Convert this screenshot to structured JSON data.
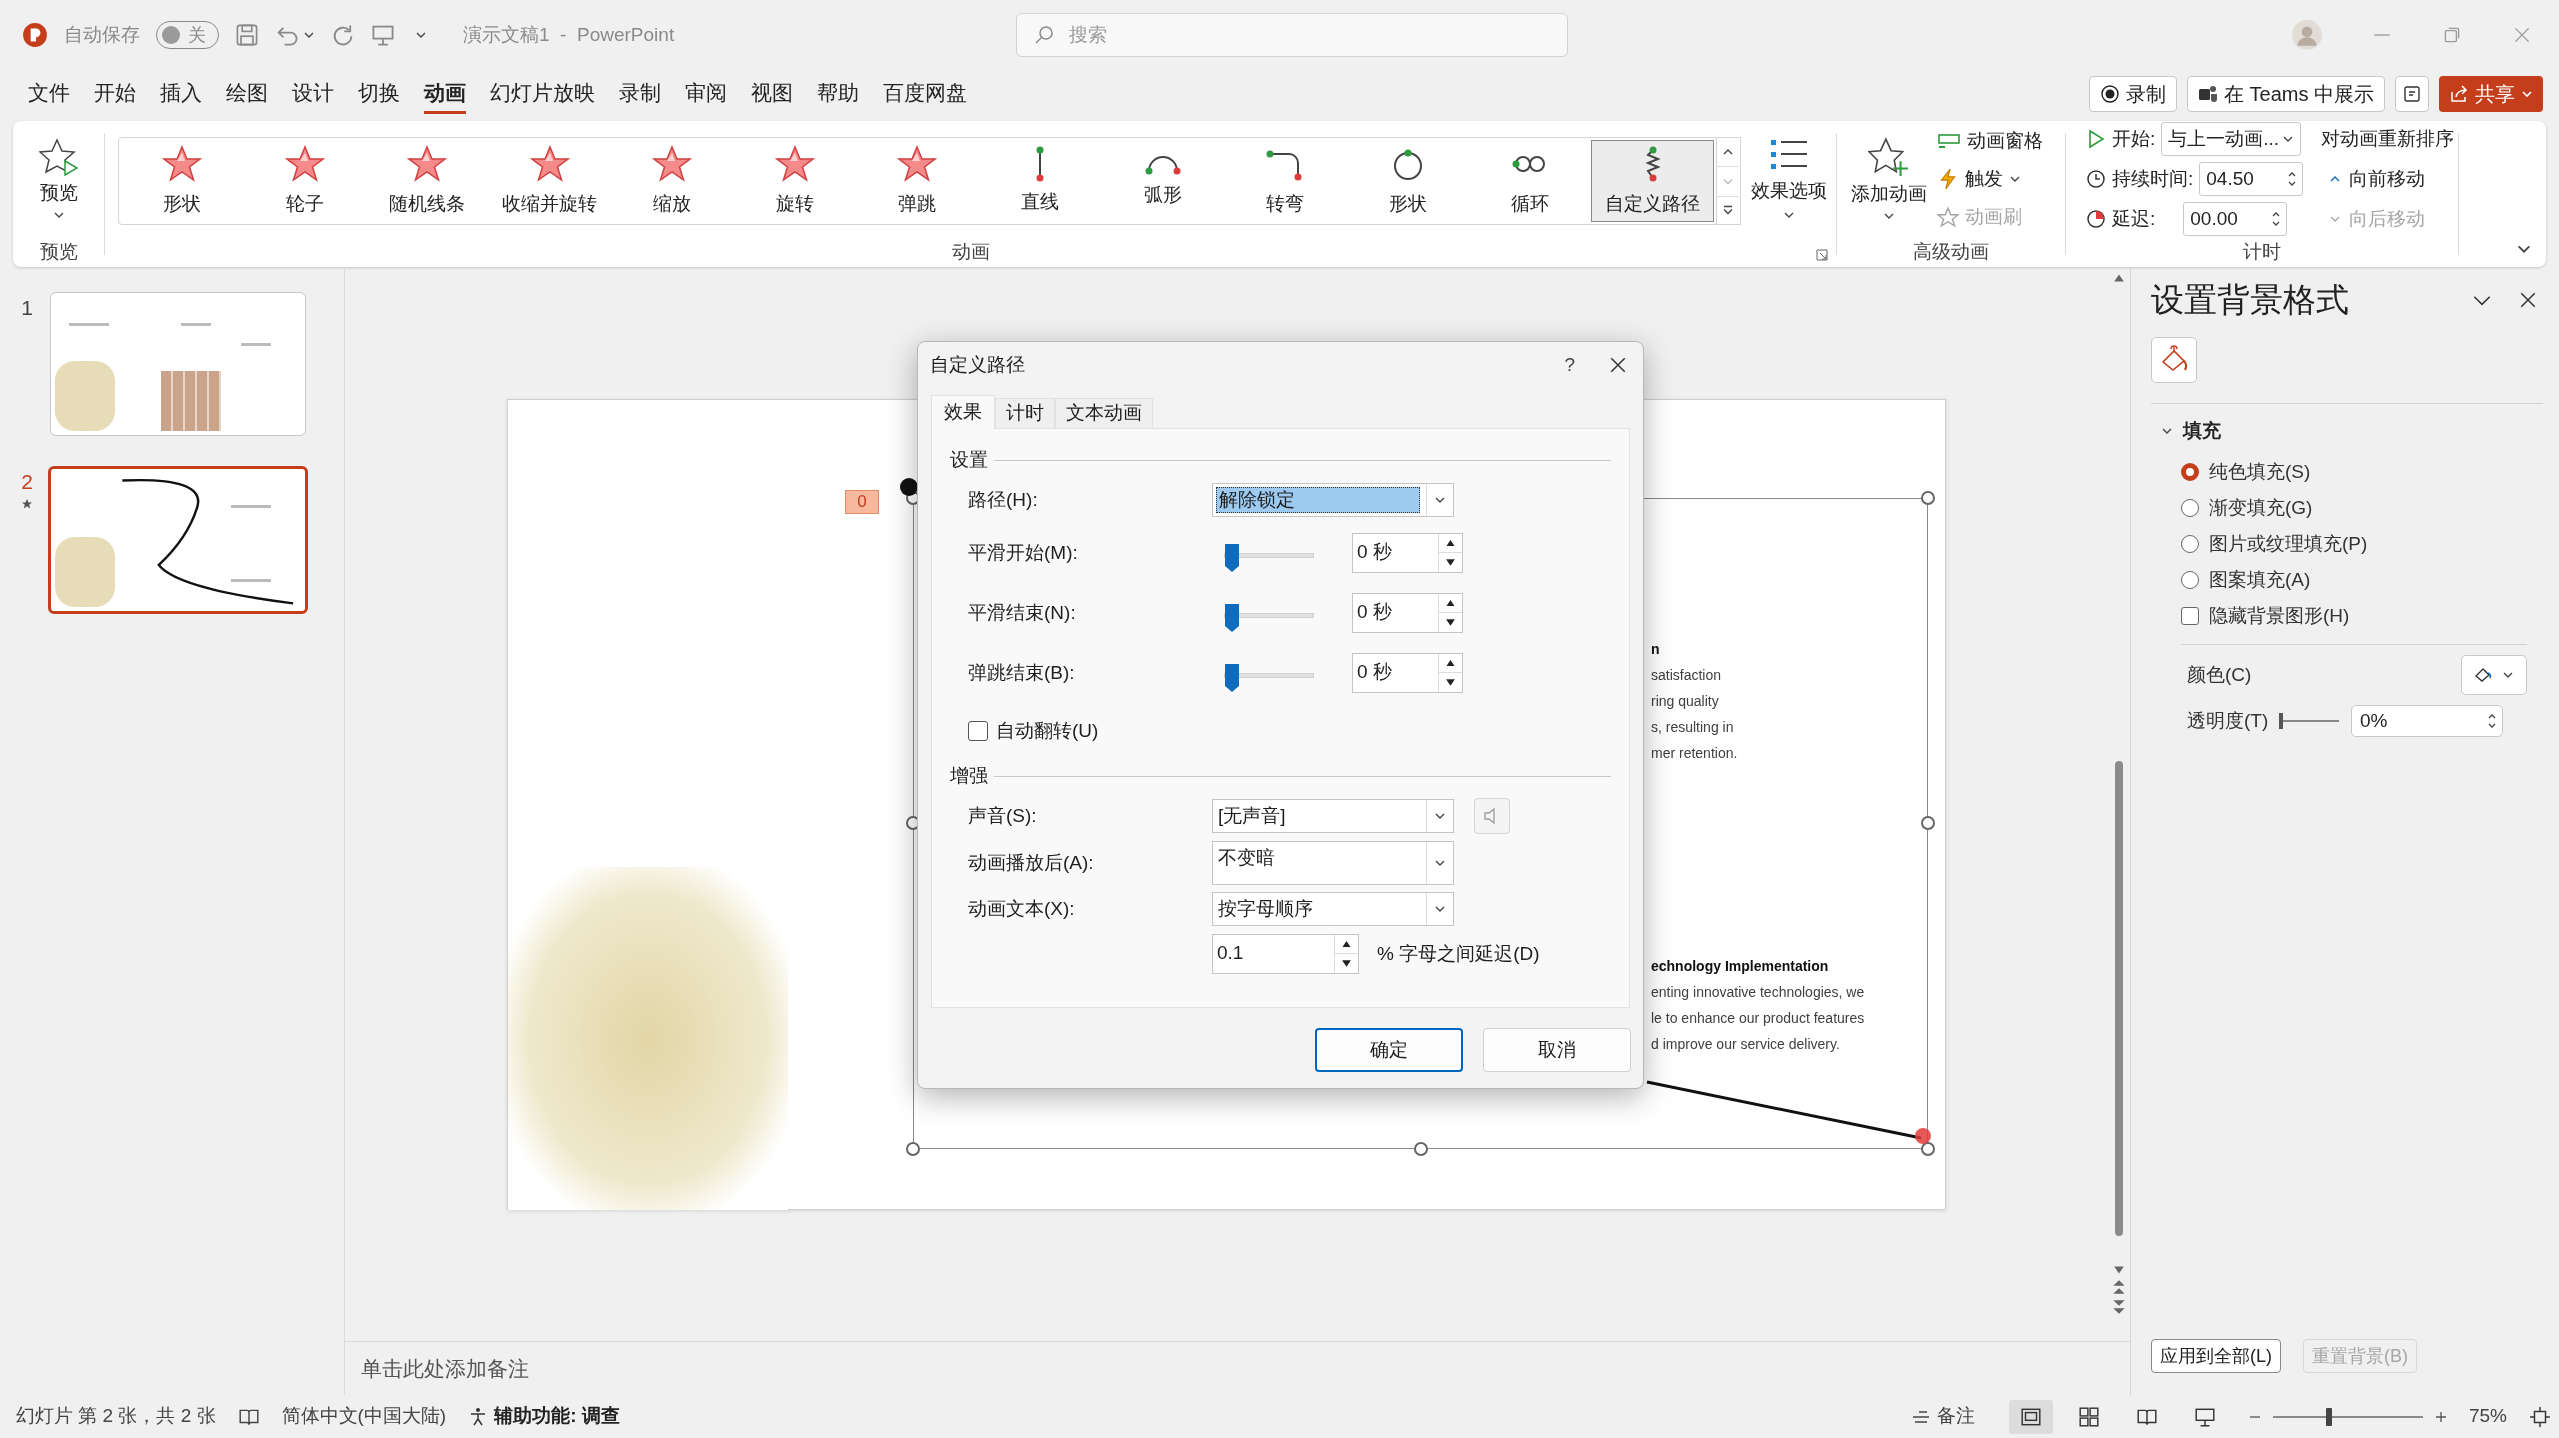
{
  "title_bar": {
    "autosave_label": "自动保存",
    "autosave": {
      "label": "关",
      "on": false
    },
    "document_title": "演示文稿1  -  PowerPoint",
    "search": {
      "placeholder": "搜索"
    }
  },
  "menu_tabs": [
    {
      "label": "文件",
      "selected": false
    },
    {
      "label": "开始",
      "selected": false
    },
    {
      "label": "插入",
      "selected": false
    },
    {
      "label": "绘图",
      "selected": false
    },
    {
      "label": "设计",
      "selected": false
    },
    {
      "label": "切换",
      "selected": false
    },
    {
      "label": "动画",
      "selected": true
    },
    {
      "label": "幻灯片放映",
      "selected": false
    },
    {
      "label": "录制",
      "selected": false
    },
    {
      "label": "审阅",
      "selected": false
    },
    {
      "label": "视图",
      "selected": false
    },
    {
      "label": "帮助",
      "selected": false
    },
    {
      "label": "百度网盘",
      "selected": false
    }
  ],
  "header_buttons": [
    {
      "kind": "record",
      "label": "录制"
    },
    {
      "kind": "teams",
      "label": "在 Teams 中展示"
    },
    {
      "kind": "share",
      "label": "共享"
    }
  ],
  "ribbon": {
    "preview": {
      "button": "预览",
      "group_label": "预览"
    },
    "animations": {
      "group_label": "动画",
      "effect_options": "效果选项",
      "items": [
        {
          "label": "形状",
          "kind": "star",
          "selected": false
        },
        {
          "label": "轮子",
          "kind": "star",
          "selected": false
        },
        {
          "label": "随机线条",
          "kind": "star",
          "selected": false
        },
        {
          "label": "收缩并旋转",
          "kind": "star",
          "selected": false
        },
        {
          "label": "缩放",
          "kind": "star",
          "selected": false
        },
        {
          "label": "旋转",
          "kind": "star",
          "selected": false
        },
        {
          "label": "弹跳",
          "kind": "star",
          "selected": false
        },
        {
          "label": "直线",
          "kind": "line",
          "selected": false
        },
        {
          "label": "弧形",
          "kind": "arc",
          "selected": false
        },
        {
          "label": "转弯",
          "kind": "turn",
          "selected": false
        },
        {
          "label": "形状",
          "kind": "circle",
          "selected": false
        },
        {
          "label": "循环",
          "kind": "loop",
          "selected": false
        },
        {
          "label": "自定义路径",
          "kind": "custom",
          "selected": true
        }
      ]
    },
    "advanced": {
      "group_label": "高级动画",
      "add_animation": "添加动画",
      "animation_pane": "动画窗格",
      "trigger": "触发",
      "painter": {
        "label": "动画刷",
        "disabled": true
      }
    },
    "timing": {
      "group_label": "计时",
      "start": {
        "label": "开始:",
        "value": "与上一动画..."
      },
      "duration": {
        "label": "持续时间:",
        "value": "04.50"
      },
      "delay": {
        "label": "延迟:",
        "value": "00.00"
      },
      "reorder": "对动画重新排序",
      "move_earlier": {
        "label": "向前移动",
        "disabled": false
      },
      "move_later": {
        "label": "向后移动",
        "disabled": true
      }
    }
  },
  "slides": [
    {
      "number": "1",
      "selected": false,
      "animated": false
    },
    {
      "number": "2",
      "selected": true,
      "animated": true
    }
  ],
  "slide": {
    "animation_badge": "0",
    "text_blocks": [
      {
        "heading": "n",
        "lines": [
          "satisfaction",
          "ring quality",
          "s, resulting in",
          "mer retention."
        ]
      },
      {
        "heading": "echnology Implementation",
        "lines": [
          "enting innovative technologies, we",
          "le to enhance our product features",
          "d improve our service delivery."
        ]
      }
    ]
  },
  "notes_placeholder": "单击此处添加备注",
  "dialog": {
    "title": "自定义路径",
    "help": "?",
    "tabs": [
      {
        "label": "效果",
        "selected": true
      },
      {
        "label": "计时",
        "selected": false
      },
      {
        "label": "文本动画",
        "selected": false
      }
    ],
    "settings": {
      "heading": "设置",
      "path": {
        "label": "路径(H):",
        "value": "解除锁定"
      },
      "sliders": [
        {
          "label": "平滑开始(M):",
          "level": 0,
          "value": "0 秒"
        },
        {
          "label": "平滑结束(N):",
          "level": 0,
          "value": "0 秒"
        },
        {
          "label": "弹跳结束(B):",
          "level": 0,
          "value": "0 秒"
        }
      ],
      "auto_reverse": {
        "label": "自动翻转(U)",
        "checked": false
      }
    },
    "enhancements": {
      "heading": "增强",
      "sound": {
        "label": "声音(S):",
        "value": "[无声音]"
      },
      "after_animation": {
        "label": "动画播放后(A):",
        "value": "不变暗"
      },
      "animate_text": {
        "label": "动画文本(X):",
        "value": "按字母顺序"
      },
      "letter_delay": {
        "value": "0.1",
        "label": "% 字母之间延迟(D)"
      }
    },
    "buttons": [
      {
        "label": "确定",
        "default": true
      },
      {
        "label": "取消",
        "default": false
      }
    ]
  },
  "format_pane": {
    "title": "设置背景格式",
    "section": {
      "label": "填充",
      "expanded": true
    },
    "fill_options": [
      {
        "label": "纯色填充(S)",
        "selected": true
      },
      {
        "label": "渐变填充(G)",
        "selected": false
      },
      {
        "label": "图片或纹理填充(P)",
        "selected": false
      },
      {
        "label": "图案填充(A)",
        "selected": false
      }
    ],
    "hide_graphics": {
      "label": "隐藏背景图形(H)",
      "checked": false
    },
    "color_label": "颜色(C)",
    "transparency": {
      "label": "透明度(T)",
      "level": 0,
      "value": "0%"
    },
    "apply_all": {
      "label": "应用到全部(L)",
      "disabled": false
    },
    "reset": {
      "label": "重置背景(B)",
      "disabled": true
    }
  },
  "status_bar": {
    "slide_info": "幻灯片 第 2 张，共 2 张",
    "language": "简体中文(中国大陆)",
    "accessibility": "辅助功能: 调查",
    "notes": "备注",
    "views": [
      {
        "kind": "normal",
        "selected": true
      },
      {
        "kind": "sorter",
        "selected": false
      },
      {
        "kind": "reading",
        "selected": false
      },
      {
        "kind": "show",
        "selected": false
      }
    ],
    "zoom": {
      "level": 0.37,
      "value": "75%"
    }
  }
}
